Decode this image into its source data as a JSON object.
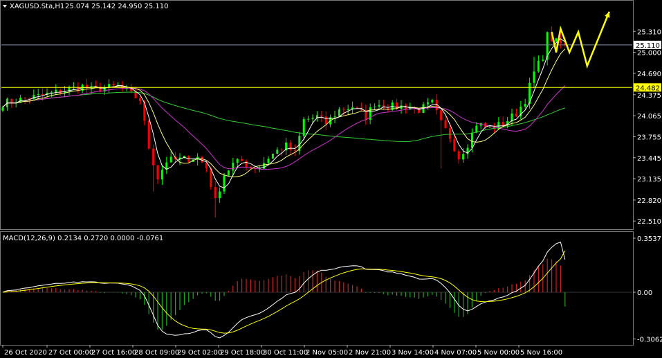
{
  "header": {
    "symbol_title": "XAGUSD.Sta,H1",
    "ohlc": "25.074 25.142 24.950 25.110"
  },
  "macd_header": "MACD(12,26,9) 0.2134 0.2720 0.0000 -0.0761",
  "colors": {
    "background": "#000000",
    "bull": "#00ff00",
    "bear": "#ff0000",
    "ma_fast": "#ffffff",
    "ma_mid": "#ffff80",
    "ma_slow1": "#cc33cc",
    "ma_slow2": "#33cc33",
    "level": "#ffff00",
    "current": "#8a94a8",
    "forecast": "#ffff00",
    "macd_line": "#ffffff",
    "signal_line": "#ffff00",
    "hist_pos": "#cc2222",
    "hist_neg": "#22aa22"
  },
  "chart_data": [
    {
      "type": "candlestick",
      "symbol": "XAGUSD.Sta",
      "timeframe": "H1",
      "ylim": [
        22.4,
        25.65
      ],
      "y_ticks": [
        "25.310",
        "25.000",
        "24.690",
        "24.375",
        "24.065",
        "23.755",
        "23.445",
        "23.135",
        "22.820",
        "22.510"
      ],
      "x_ticks": [
        "26 Oct 2020",
        "27 Oct 00:00",
        "27 Oct 16:00",
        "28 Oct 09:00",
        "29 Oct 02:00",
        "29 Oct 18:00",
        "30 Oct 11:00",
        "2 Nov 05:00",
        "2 Nov 21:00",
        "3 Nov 14:00",
        "4 Nov 07:00",
        "5 Nov 00:00",
        "5 Nov 16:00"
      ],
      "levels": [
        {
          "label": "24.482",
          "value": 24.482,
          "style": "support"
        },
        {
          "label": "25.110",
          "value": 25.11,
          "style": "current"
        }
      ],
      "price_path": [
        [
          0,
          24.25
        ],
        [
          10,
          24.38
        ],
        [
          18,
          24.5
        ],
        [
          20,
          24.45
        ],
        [
          26,
          24.5
        ],
        [
          28,
          24.42
        ],
        [
          31,
          24.3
        ],
        [
          33,
          23.6
        ],
        [
          35,
          23.15
        ],
        [
          37,
          23.4
        ],
        [
          40,
          23.42
        ],
        [
          44,
          23.45
        ],
        [
          46,
          23.3
        ],
        [
          48,
          22.8
        ],
        [
          50,
          23.2
        ],
        [
          52,
          23.35
        ],
        [
          54,
          23.4
        ],
        [
          56,
          23.3
        ],
        [
          58,
          23.3
        ],
        [
          60,
          23.45
        ],
        [
          62,
          23.55
        ],
        [
          64,
          23.62
        ],
        [
          66,
          23.5
        ],
        [
          68,
          24.0
        ],
        [
          71,
          24.05
        ],
        [
          73,
          23.95
        ],
        [
          76,
          24.15
        ],
        [
          79,
          24.2
        ],
        [
          82,
          24.05
        ],
        [
          84,
          24.25
        ],
        [
          87,
          24.2
        ],
        [
          91,
          24.2
        ],
        [
          94,
          24.15
        ],
        [
          97,
          24.25
        ],
        [
          99,
          23.95
        ],
        [
          101,
          23.75
        ],
        [
          103,
          23.45
        ],
        [
          105,
          23.65
        ],
        [
          107,
          23.95
        ],
        [
          110,
          23.88
        ],
        [
          113,
          23.95
        ],
        [
          116,
          24.1
        ],
        [
          118,
          24.3
        ],
        [
          120,
          24.7
        ],
        [
          122,
          24.95
        ],
        [
          123,
          25.25
        ],
        [
          125,
          25.15
        ],
        [
          127,
          25.11
        ]
      ],
      "candle_count": 128,
      "forecast_path": [
        [
          124,
          25.3
        ],
        [
          125,
          25.0
        ],
        [
          126,
          25.35
        ],
        [
          128,
          25.0
        ],
        [
          130,
          25.3
        ],
        [
          132,
          24.8
        ],
        [
          137,
          25.6
        ]
      ]
    },
    {
      "type": "macd",
      "params": [
        12,
        26,
        9
      ],
      "values": {
        "macd": 0.2134,
        "signal": 0.272,
        "zero": 0.0,
        "histogram": -0.0761
      },
      "ylim": [
        -0.34,
        0.39
      ],
      "y_ticks": [
        "0.3537",
        "0.00",
        "-0.3062"
      ]
    }
  ]
}
